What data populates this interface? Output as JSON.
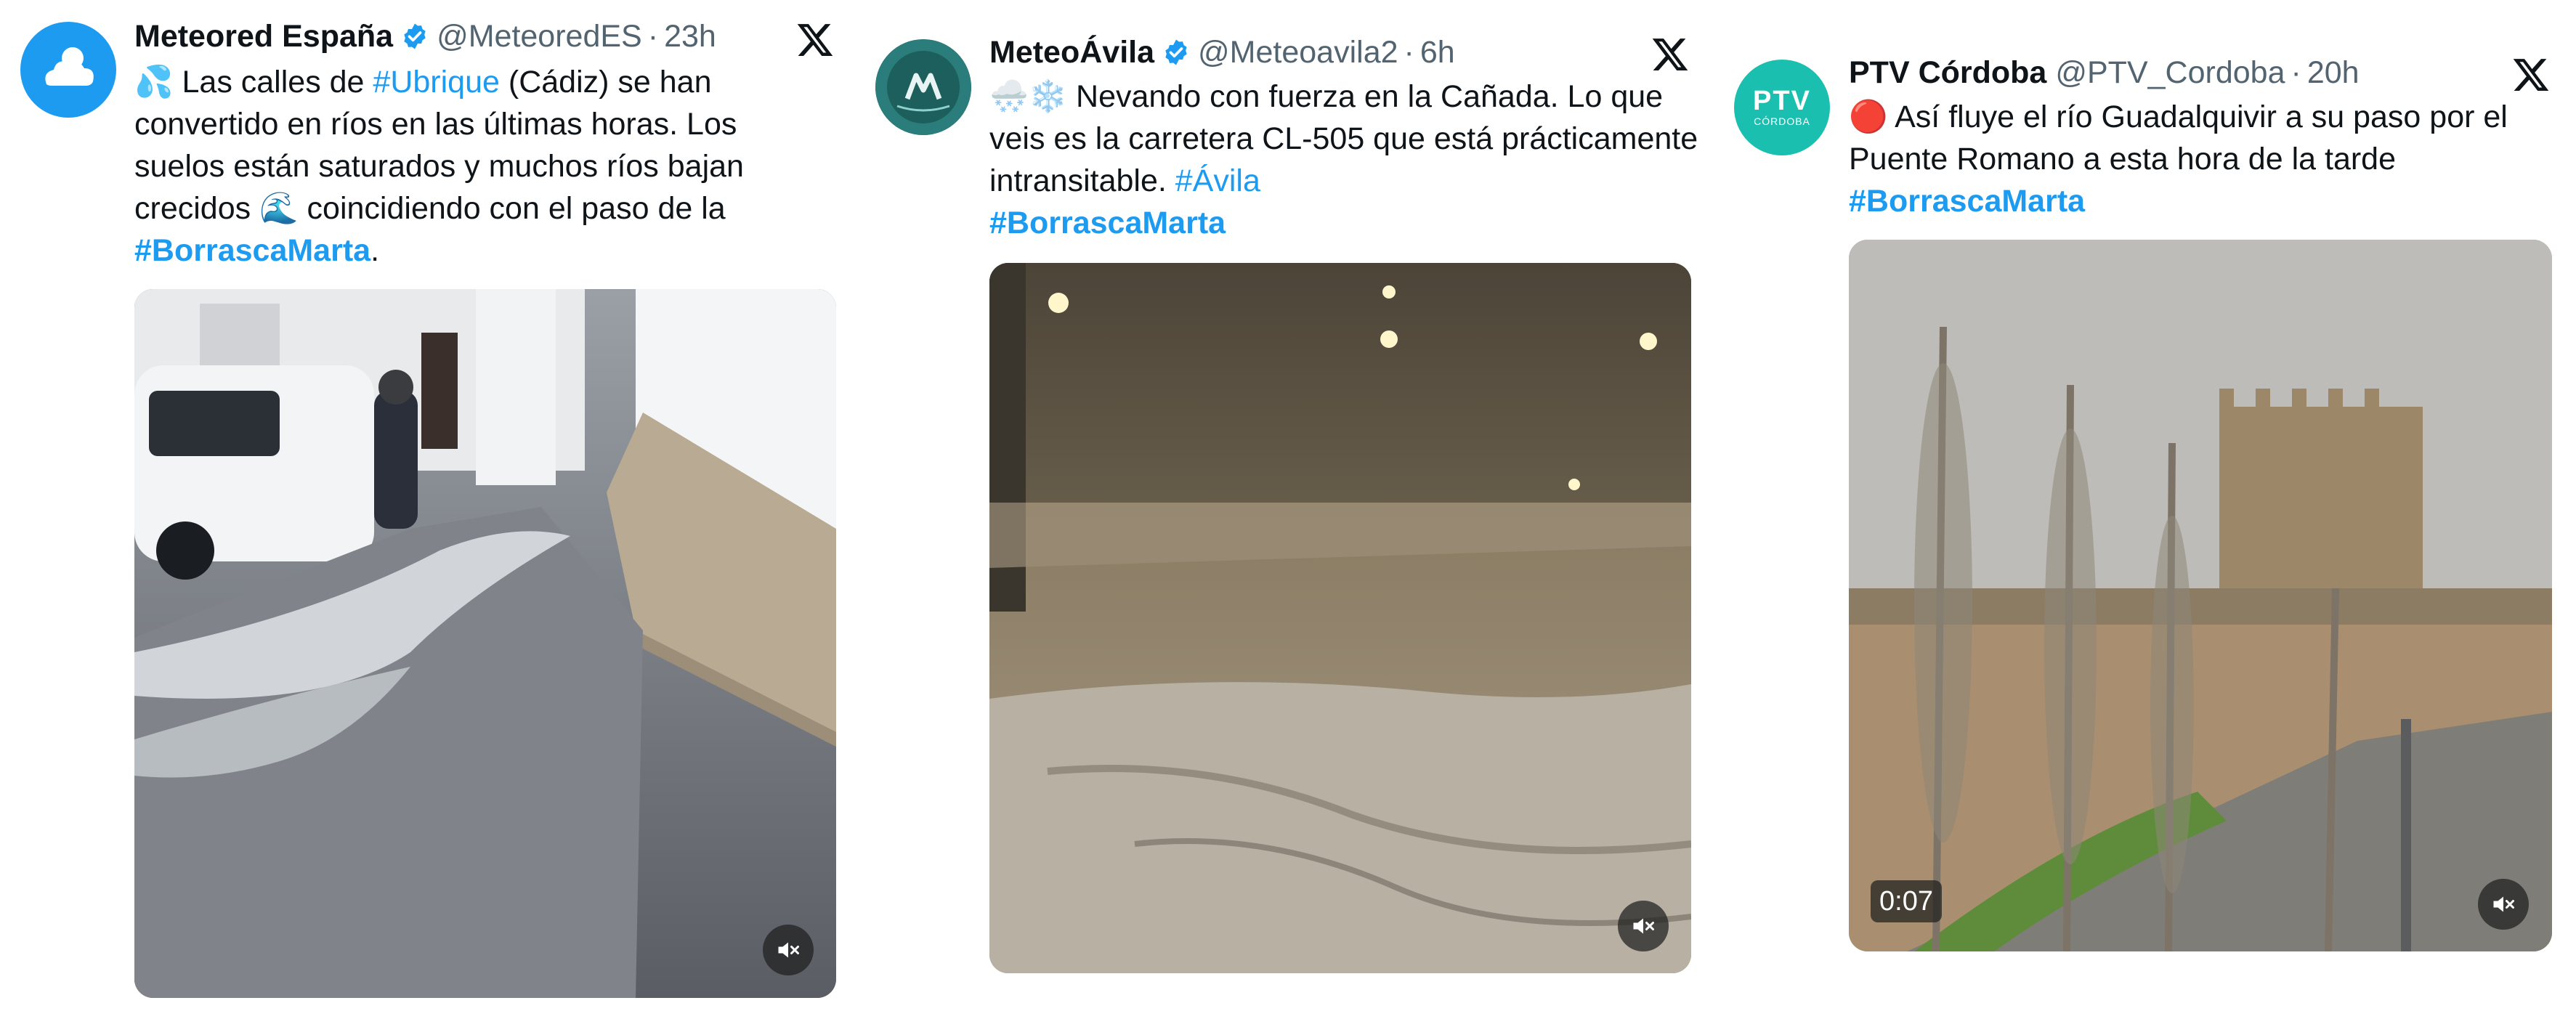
{
  "tweets": [
    {
      "name": "Meteored España",
      "handle": "@MeteoredES",
      "separator": "·",
      "time": "23h",
      "text": {
        "p1": "💦 Las calles de ",
        "tag1": "#Ubrique",
        "p2": " (Cádiz) se han convertido en ríos en las últimas horas. Los suelos están saturados y muchos ríos bajan crecidos 🌊 coincidiendo con el paso de la ",
        "tag2": "#BorrascaMarta",
        "p3": "."
      },
      "media": {
        "type": "video",
        "muted_icon": "speaker-muted-icon"
      }
    },
    {
      "name": "MeteoÁvila",
      "handle": "@Meteoavila2",
      "separator": "·",
      "time": "6h",
      "text": {
        "p1": "🌨️❄️ Nevando con fuerza en la Cañada. Lo que veis es la carretera CL-505 que está prácticamente intransitable. ",
        "tag1": "#Ávila",
        "tag2": "#BorrascaMarta"
      },
      "media": {
        "type": "video",
        "muted_icon": "speaker-muted-icon"
      }
    },
    {
      "name": "PTV Córdoba",
      "handle": "@PTV_Cordoba",
      "separator": "·",
      "time": "20h",
      "avatar_text": {
        "top": "PTV",
        "bottom": "CÓRDOBA"
      },
      "text": {
        "p1": "🔴 Así fluye el río Guadalquivir a su paso por el Puente Romano a esta hora de la tarde",
        "tag1": "#BorrascaMarta"
      },
      "media": {
        "type": "video",
        "duration": "0:07",
        "muted_icon": "speaker-muted-icon"
      }
    }
  ],
  "colors": {
    "link": "#1d9bf0",
    "verified": "#1d9bf0",
    "meteored_avatar": "#1d9bf0",
    "ptv_avatar": "#1abfb0"
  }
}
